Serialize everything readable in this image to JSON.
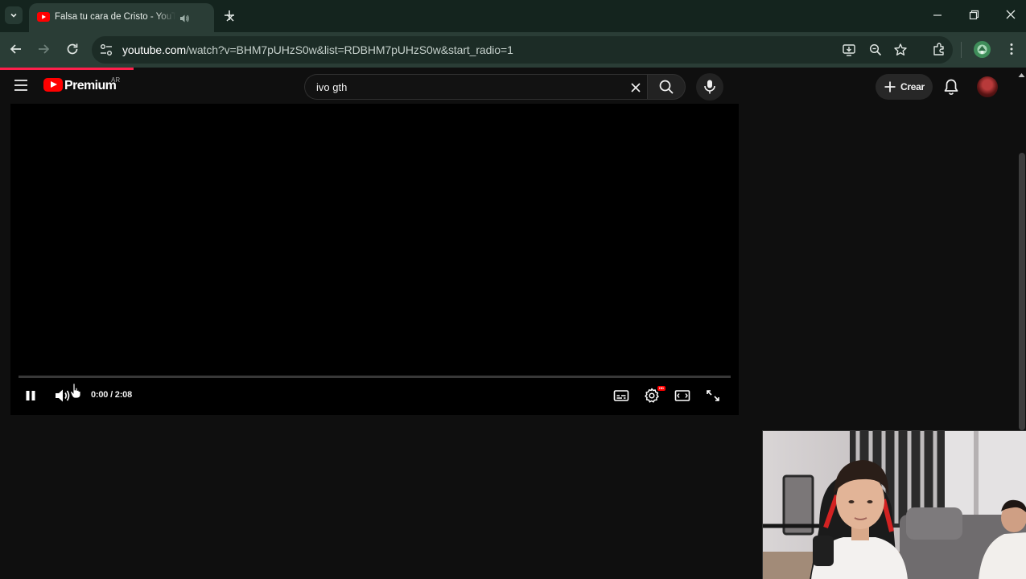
{
  "browser": {
    "tab": {
      "title": "Falsa tu cara de Cristo - YouTube"
    },
    "url": {
      "host": "youtube.com",
      "path": "/watch?v=BHM7pUHzS0w&list=RDBHM7pUHzS0w&start_radio=1"
    },
    "page_load_progress": 0.13
  },
  "youtube": {
    "logo_text": "Premium",
    "region": "AR",
    "search": {
      "value": "ivo gth"
    },
    "create_label": "Crear"
  },
  "player": {
    "time": "0:00 / 2:08",
    "progress": 0,
    "state": "playing",
    "hd_badge": "HD"
  },
  "colors": {
    "accent": "#ff0000",
    "chrome_frame": "#14241e",
    "chrome_toolbar": "#2a3d36",
    "yt_background": "#0f0f0f"
  },
  "icons": [
    "tab-list-icon",
    "youtube-favicon",
    "speaker-icon",
    "close-icon",
    "plus-icon",
    "minimize-icon",
    "restore-icon",
    "back-icon",
    "forward-icon",
    "reload-icon",
    "site-info-icon",
    "install-icon",
    "zoom-icon",
    "star-icon",
    "extensions-icon",
    "profile-icon",
    "more-icon",
    "menu-icon",
    "search-icon",
    "mic-icon",
    "bell-icon",
    "pause-icon",
    "volume-icon",
    "subtitles-icon",
    "settings-icon",
    "theater-icon",
    "fullscreen-icon"
  ]
}
